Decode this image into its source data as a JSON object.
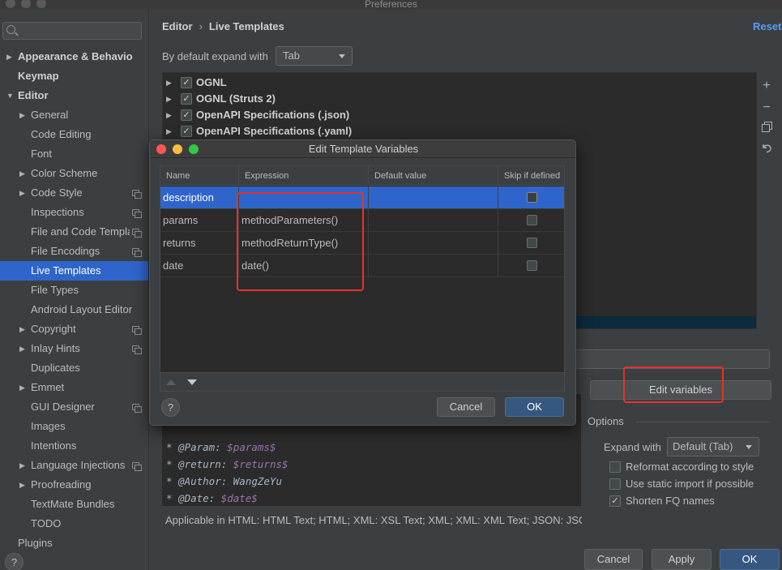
{
  "window": {
    "title": "Preferences"
  },
  "sidebar": {
    "search_placeholder": "",
    "items": [
      {
        "label": "Appearance & Behavior",
        "bold": true
      },
      {
        "label": "Keymap",
        "bold": true
      },
      {
        "label": "Editor",
        "bold": true
      },
      {
        "label": "General"
      },
      {
        "label": "Code Editing"
      },
      {
        "label": "Font"
      },
      {
        "label": "Color Scheme"
      },
      {
        "label": "Code Style"
      },
      {
        "label": "Inspections"
      },
      {
        "label": "File and Code Templa"
      },
      {
        "label": "File Encodings"
      },
      {
        "label": "Live Templates",
        "selected": true
      },
      {
        "label": "File Types"
      },
      {
        "label": "Android Layout Editor"
      },
      {
        "label": "Copyright"
      },
      {
        "label": "Inlay Hints"
      },
      {
        "label": "Duplicates"
      },
      {
        "label": "Emmet"
      },
      {
        "label": "GUI Designer"
      },
      {
        "label": "Images"
      },
      {
        "label": "Intentions"
      },
      {
        "label": "Language Injections"
      },
      {
        "label": "Proofreading"
      },
      {
        "label": "TextMate Bundles"
      },
      {
        "label": "TODO"
      },
      {
        "label": "Plugins"
      }
    ],
    "help": "?"
  },
  "main": {
    "breadcrumb": {
      "parent": "Editor",
      "separator": "›",
      "current": "Live Templates"
    },
    "reset": "Reset",
    "expand_label": "By default expand with",
    "expand_value": "Tab",
    "templates": [
      {
        "label": "OGNL",
        "checked": "✓"
      },
      {
        "label": "OGNL (Struts 2)",
        "checked": "✓"
      },
      {
        "label": "OpenAPI Specifications (.json)",
        "checked": "✓"
      },
      {
        "label": "OpenAPI Specifications (.yaml)",
        "checked": "✓"
      }
    ],
    "toolbar": {
      "add": "+",
      "remove": "−"
    },
    "edit_variables": "Edit variables",
    "code_lines": [
      {
        "prefix": "* @Param: ",
        "var": "$params$"
      },
      {
        "prefix": "* @return: ",
        "var": "$returns$"
      },
      {
        "prefix": "* @Author: WangZeYu",
        "var": ""
      },
      {
        "prefix": "* @Date: ",
        "var": "$date$"
      },
      {
        "prefix": "*/",
        "var": ""
      }
    ],
    "applicable": "Applicable in HTML: HTML Text; HTML; XML: XSL Text; XML; XML: XML Text; JSON: JSO",
    "options": {
      "title": "Options",
      "expand_with_label": "Expand with",
      "expand_with_value": "Default (Tab)",
      "checkboxes": [
        {
          "label": "Reformat according to style",
          "checked": ""
        },
        {
          "label": "Use static import if possible",
          "checked": ""
        },
        {
          "label": "Shorten FQ names",
          "checked": "✓"
        }
      ]
    },
    "buttons": {
      "cancel": "Cancel",
      "apply": "Apply",
      "ok": "OK"
    }
  },
  "dialog": {
    "title": "Edit Template Variables",
    "columns": [
      "Name",
      "Expression",
      "Default value",
      "Skip if defined"
    ],
    "rows": [
      {
        "name": "description",
        "expression": "",
        "default": "",
        "skip": false
      },
      {
        "name": "params",
        "expression": "methodParameters()",
        "default": "",
        "skip": false
      },
      {
        "name": "returns",
        "expression": "methodReturnType()",
        "default": "",
        "skip": false
      },
      {
        "name": "date",
        "expression": "date()",
        "default": "",
        "skip": false
      }
    ],
    "help": "?",
    "cancel": "Cancel",
    "ok": "OK"
  },
  "colors": {
    "accent": "#2f65ca",
    "annotation": "#e8322a",
    "link": "#589df6"
  }
}
